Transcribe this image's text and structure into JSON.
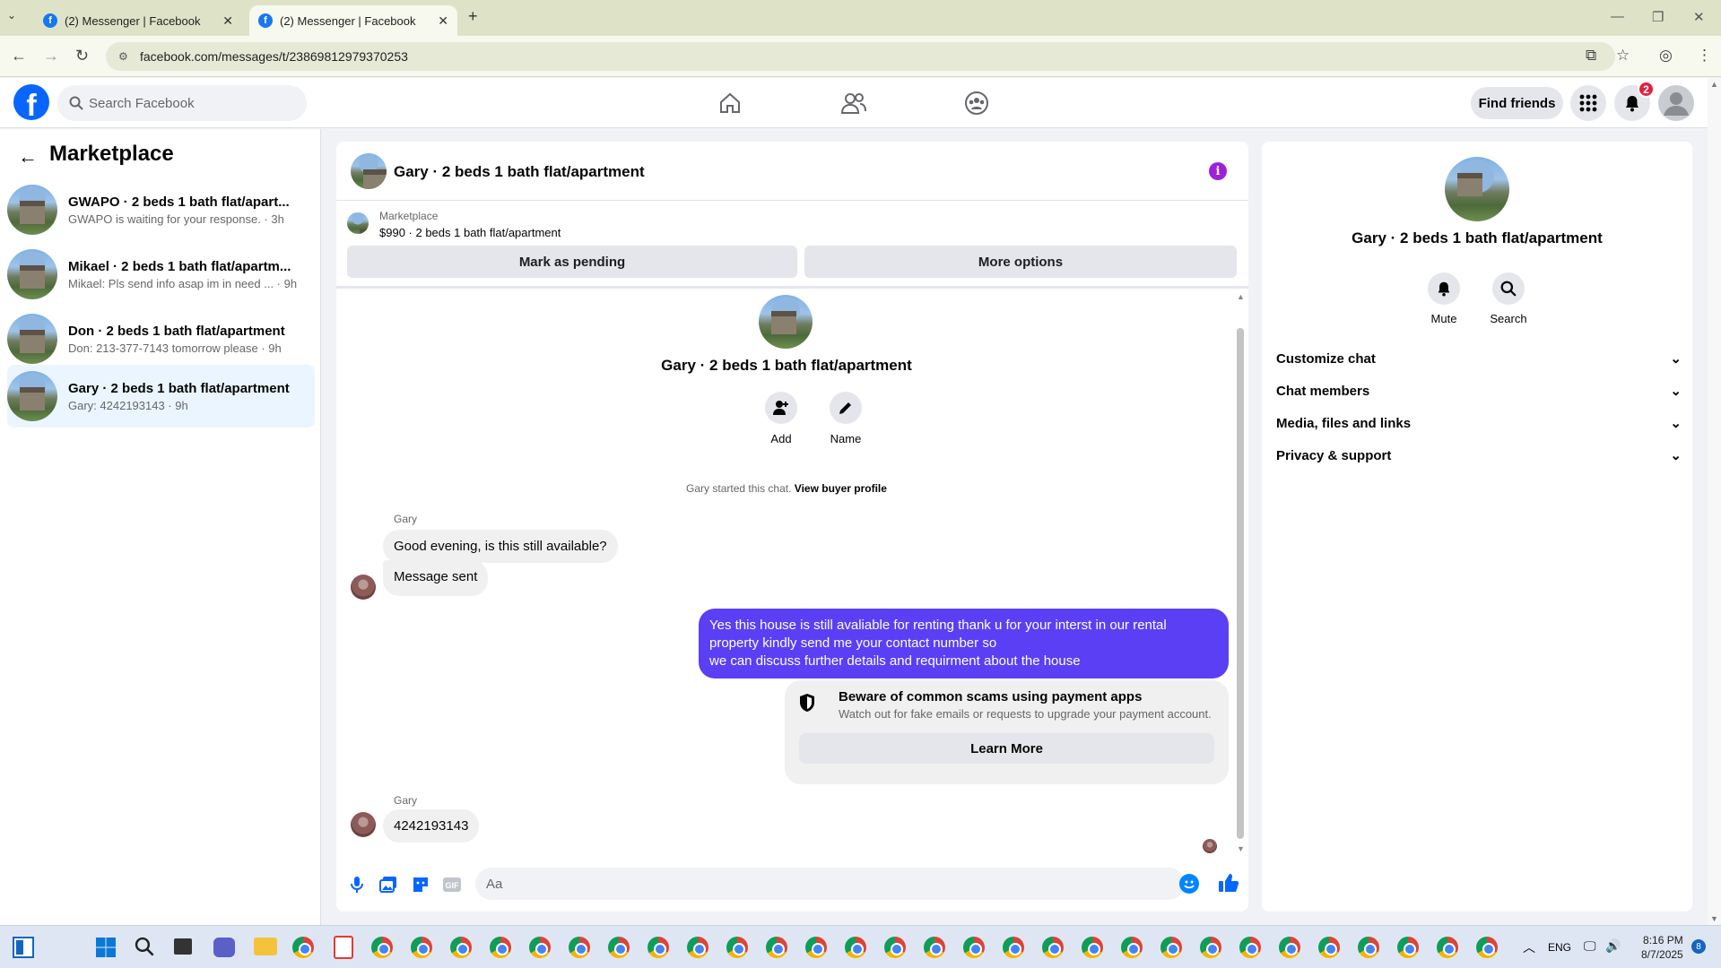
{
  "browser": {
    "tabs": [
      {
        "title": "(2) Messenger | Facebook"
      },
      {
        "title": "(2) Messenger | Facebook"
      }
    ],
    "url": "facebook.com/messages/t/23869812979370253"
  },
  "header": {
    "search_placeholder": "Search Facebook",
    "find_friends": "Find friends",
    "notification_count": "2"
  },
  "sidebar": {
    "title": "Marketplace",
    "conversations": [
      {
        "name": "GWAPO · 2 beds 1 bath flat/apart...",
        "preview": "GWAPO is waiting for your response. · 3h"
      },
      {
        "name": "Mikael · 2 beds 1 bath flat/apartm...",
        "preview": "Mikael: Pls send info asap im in need ... · 9h"
      },
      {
        "name": "Don · 2 beds 1 bath flat/apartment",
        "preview": "Don: 213-377-7143 tomorrow please · 9h"
      },
      {
        "name": "Gary · 2 beds 1 bath flat/apartment",
        "preview": "Gary: 4242193143 · 9h"
      }
    ]
  },
  "chat": {
    "title": "Gary · 2 beds 1 bath flat/apartment",
    "listing_label": "Marketplace",
    "listing_price": "$990 · 2 beds 1 bath flat/apartment",
    "mark_pending": "Mark as pending",
    "more_options": "More options",
    "center_name": "Gary · 2 beds 1 bath flat/apartment",
    "add_label": "Add",
    "name_label": "Name",
    "started_text": "Gary started this chat.",
    "view_profile": "View buyer profile",
    "messages": [
      {
        "sender": "Gary",
        "text": "Good evening, is this still available?"
      },
      {
        "text": "Message sent"
      },
      {
        "text": "Yes this house is still avaliable for renting thank u for your interst in our rental property kindly send me your contact number so"
      },
      {
        "text": "we can discuss further details and requirment about the house"
      },
      {
        "sender": "Gary",
        "text": "4242193143"
      }
    ],
    "scam_title": "Beware of common scams using payment apps",
    "scam_sub": "Watch out for fake emails or requests to upgrade your payment account.",
    "learn_more": "Learn More",
    "input_placeholder": "Aa"
  },
  "details": {
    "name": "Gary · 2 beds 1 bath flat/apartment",
    "mute": "Mute",
    "search": "Search",
    "sections": [
      "Customize chat",
      "Chat members",
      "Media, files and links",
      "Privacy & support"
    ]
  },
  "taskbar": {
    "lang": "ENG",
    "time": "8:16 PM",
    "date": "8/7/2025"
  },
  "colors": {
    "fb_blue": "#0866ff",
    "outgoing_bubble": "#5b3ff5",
    "active_conv": "#ebf5ff"
  }
}
